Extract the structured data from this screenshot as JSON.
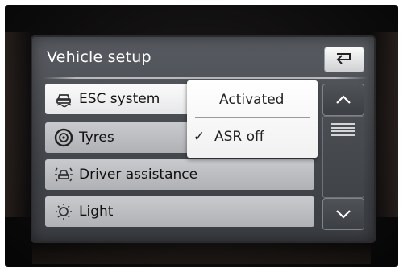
{
  "screen": {
    "title": "Vehicle setup",
    "back_icon": "back-arrow-icon"
  },
  "menu": {
    "items": [
      {
        "label": "ESC system",
        "icon": "car-skid-icon",
        "selected": true
      },
      {
        "label": "Tyres",
        "icon": "tyre-icon",
        "selected": false
      },
      {
        "label": "Driver assistance",
        "icon": "driver-assist-icon",
        "selected": false
      },
      {
        "label": "Light",
        "icon": "light-bulb-icon",
        "selected": false
      }
    ]
  },
  "popup": {
    "options": [
      {
        "label": "Activated",
        "checked": false
      },
      {
        "label": "ASR off",
        "checked": true
      }
    ],
    "check_mark": "✓"
  },
  "scroll": {
    "up_icon": "chevron-up-icon",
    "down_icon": "chevron-down-icon",
    "position": 0.0
  },
  "colors": {
    "screen_bg": "#4a4d52",
    "item_bg": "#c0c1c4",
    "selected_bg": "#f5f5f6",
    "text": "#111111",
    "title_text": "#ffffff"
  }
}
